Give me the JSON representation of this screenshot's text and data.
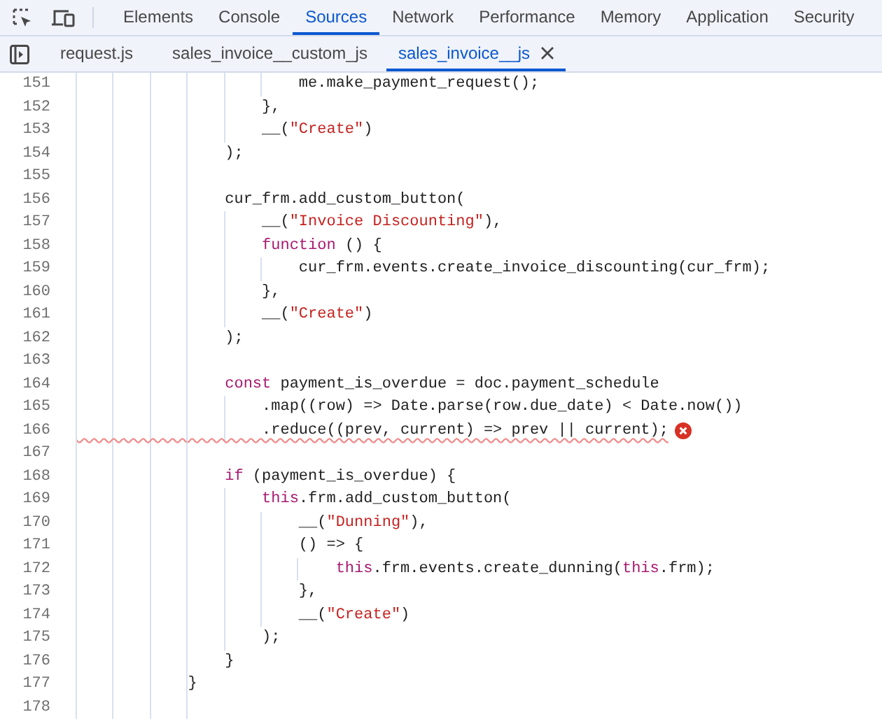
{
  "panel_tabs": [
    {
      "label": "Elements",
      "selected": false
    },
    {
      "label": "Console",
      "selected": false
    },
    {
      "label": "Sources",
      "selected": true
    },
    {
      "label": "Network",
      "selected": false
    },
    {
      "label": "Performance",
      "selected": false
    },
    {
      "label": "Memory",
      "selected": false
    },
    {
      "label": "Application",
      "selected": false
    },
    {
      "label": "Security",
      "selected": false
    }
  ],
  "file_tabs": [
    {
      "label": "request.js",
      "selected": false
    },
    {
      "label": "sales_invoice__custom_js",
      "selected": false
    },
    {
      "label": "sales_invoice__js",
      "selected": true
    }
  ],
  "code_lines": [
    {
      "number": "151",
      "error": false,
      "tokens": [
        {
          "kind": "plain",
          "text": "                        me.make_payment_request();"
        }
      ]
    },
    {
      "number": "152",
      "error": false,
      "tokens": [
        {
          "kind": "plain",
          "text": "                    },"
        }
      ]
    },
    {
      "number": "153",
      "error": false,
      "tokens": [
        {
          "kind": "plain",
          "text": "                    __("
        },
        {
          "kind": "string",
          "text": "\"Create\""
        },
        {
          "kind": "plain",
          "text": ")"
        }
      ]
    },
    {
      "number": "154",
      "error": false,
      "tokens": [
        {
          "kind": "plain",
          "text": "                );"
        }
      ]
    },
    {
      "number": "155"
    },
    {
      "number": "156",
      "error": false,
      "tokens": [
        {
          "kind": "plain",
          "text": "                cur_frm.add_custom_button("
        }
      ]
    },
    {
      "number": "157",
      "error": false,
      "tokens": [
        {
          "kind": "plain",
          "text": "                    __("
        },
        {
          "kind": "string",
          "text": "\"Invoice Discounting\""
        },
        {
          "kind": "plain",
          "text": "),"
        }
      ]
    },
    {
      "number": "158",
      "error": false,
      "tokens": [
        {
          "kind": "keyword",
          "text": "                    function"
        },
        {
          "kind": "plain",
          "text": " () {"
        }
      ]
    },
    {
      "number": "159",
      "error": false,
      "tokens": [
        {
          "kind": "plain",
          "text": "                        cur_frm.events.create_invoice_discounting(cur_frm);"
        }
      ]
    },
    {
      "number": "160",
      "error": false,
      "tokens": [
        {
          "kind": "plain",
          "text": "                    },"
        }
      ]
    },
    {
      "number": "161",
      "error": false,
      "tokens": [
        {
          "kind": "plain",
          "text": "                    __("
        },
        {
          "kind": "string",
          "text": "\"Create\""
        },
        {
          "kind": "plain",
          "text": ")"
        }
      ]
    },
    {
      "number": "162",
      "error": false,
      "tokens": [
        {
          "kind": "plain",
          "text": "                );"
        }
      ]
    },
    {
      "number": "163"
    },
    {
      "number": "164",
      "error": false,
      "tokens": [
        {
          "kind": "keyword",
          "text": "                const"
        },
        {
          "kind": "plain",
          "text": " payment_is_overdue = doc.payment_schedule"
        }
      ]
    },
    {
      "number": "165",
      "error": false,
      "tokens": [
        {
          "kind": "plain",
          "text": "                    .map((row) => Date.parse(row.due_date) < Date.now())"
        }
      ]
    },
    {
      "number": "166",
      "error": true,
      "tokens": [
        {
          "kind": "plain",
          "text": "                    .reduce((prev, current) => prev || current);"
        }
      ]
    },
    {
      "number": "167"
    },
    {
      "number": "168",
      "error": false,
      "tokens": [
        {
          "kind": "keyword",
          "text": "                if"
        },
        {
          "kind": "plain",
          "text": " (payment_is_overdue) {"
        }
      ]
    },
    {
      "number": "169",
      "error": false,
      "tokens": [
        {
          "kind": "keyword",
          "text": "                    this"
        },
        {
          "kind": "plain",
          "text": ".frm.add_custom_button("
        }
      ]
    },
    {
      "number": "170",
      "error": false,
      "tokens": [
        {
          "kind": "plain",
          "text": "                        __("
        },
        {
          "kind": "string",
          "text": "\"Dunning\""
        },
        {
          "kind": "plain",
          "text": "),"
        }
      ]
    },
    {
      "number": "171",
      "error": false,
      "tokens": [
        {
          "kind": "plain",
          "text": "                        () => {"
        }
      ]
    },
    {
      "number": "172",
      "error": false,
      "tokens": [
        {
          "kind": "keyword",
          "text": "                            this"
        },
        {
          "kind": "plain",
          "text": ".frm.events.create_dunning("
        },
        {
          "kind": "keyword",
          "text": "this"
        },
        {
          "kind": "plain",
          "text": ".frm);"
        }
      ]
    },
    {
      "number": "173",
      "error": false,
      "tokens": [
        {
          "kind": "plain",
          "text": "                        },"
        }
      ]
    },
    {
      "number": "174",
      "error": false,
      "tokens": [
        {
          "kind": "plain",
          "text": "                        __("
        },
        {
          "kind": "string",
          "text": "\"Create\""
        },
        {
          "kind": "plain",
          "text": ")"
        }
      ]
    },
    {
      "number": "175",
      "error": false,
      "tokens": [
        {
          "kind": "plain",
          "text": "                    );"
        }
      ]
    },
    {
      "number": "176",
      "error": false,
      "tokens": [
        {
          "kind": "plain",
          "text": "                }"
        }
      ]
    },
    {
      "number": "177",
      "error": false,
      "tokens": [
        {
          "kind": "plain",
          "text": "            }"
        }
      ]
    },
    {
      "number": "178"
    }
  ]
}
